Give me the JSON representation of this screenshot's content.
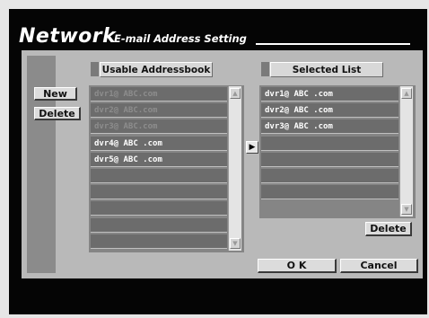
{
  "header": {
    "title": "Network",
    "subtitle": "E-mail Address Setting"
  },
  "side_buttons": {
    "new_label": "New",
    "delete_label": "Delete"
  },
  "usable": {
    "header": "Usable Addressbook",
    "rows": [
      {
        "text": "dvr1@ ABC.com",
        "dim": true
      },
      {
        "text": "dvr2@ ABC.com",
        "dim": true
      },
      {
        "text": "dvr3@ ABC.com",
        "dim": true
      },
      {
        "text": "dvr4@ ABC .com",
        "dim": false
      },
      {
        "text": "dvr5@ ABC .com",
        "dim": false
      },
      {
        "text": "",
        "dim": false
      },
      {
        "text": "",
        "dim": false
      },
      {
        "text": "",
        "dim": false
      },
      {
        "text": "",
        "dim": false
      },
      {
        "text": "",
        "dim": false
      }
    ]
  },
  "move_button": {
    "glyph": "▶"
  },
  "selected": {
    "header": "Selected List",
    "rows": [
      {
        "text": "dvr1@ ABC .com"
      },
      {
        "text": "dvr2@ ABC .com"
      },
      {
        "text": "dvr3@ ABC .com"
      },
      {
        "text": ""
      },
      {
        "text": ""
      },
      {
        "text": ""
      },
      {
        "text": ""
      }
    ],
    "delete_label": "Delete"
  },
  "footer": {
    "ok_label": "O K",
    "cancel_label": "Cancel"
  },
  "colors": {
    "panel_bg": "#050505",
    "body_bg": "#b9b9b9",
    "row_bg": "#6c6c6c",
    "button_bg": "#dcdcdc"
  }
}
